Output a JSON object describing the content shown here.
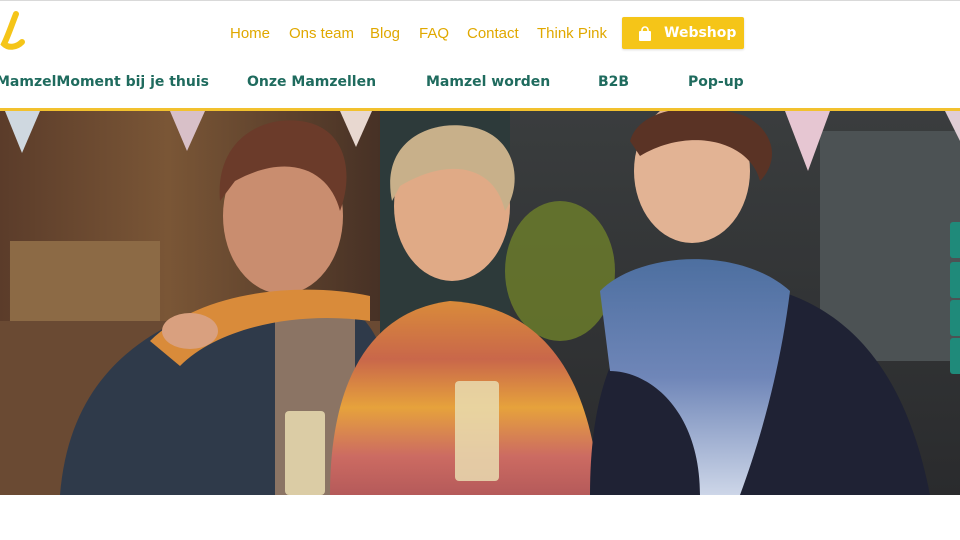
{
  "colors": {
    "accent_yellow": "#f5c518",
    "nav_yellow": "#e0a800",
    "nav_green": "#1f6b5e",
    "side_tab_teal": "#1f8a7a"
  },
  "logo": {
    "icon": "logo-glyph"
  },
  "top_nav": {
    "items": [
      {
        "label": "Home"
      },
      {
        "label": "Ons team"
      },
      {
        "label": "Blog"
      },
      {
        "label": "FAQ"
      },
      {
        "label": "Contact"
      },
      {
        "label": "Think Pink"
      }
    ],
    "webshop": {
      "label": "Webshop",
      "icon": "shopping-bag-icon"
    }
  },
  "main_nav": {
    "items": [
      {
        "label": "MamzelMoment bij je thuis"
      },
      {
        "label": "Onze Mamzellen"
      },
      {
        "label": "Mamzel worden"
      },
      {
        "label": "B2B"
      },
      {
        "label": "Pop-up"
      }
    ]
  },
  "hero": {
    "image": "photo-three-women-holding-glasses"
  },
  "side_tabs": {
    "count": 4
  }
}
